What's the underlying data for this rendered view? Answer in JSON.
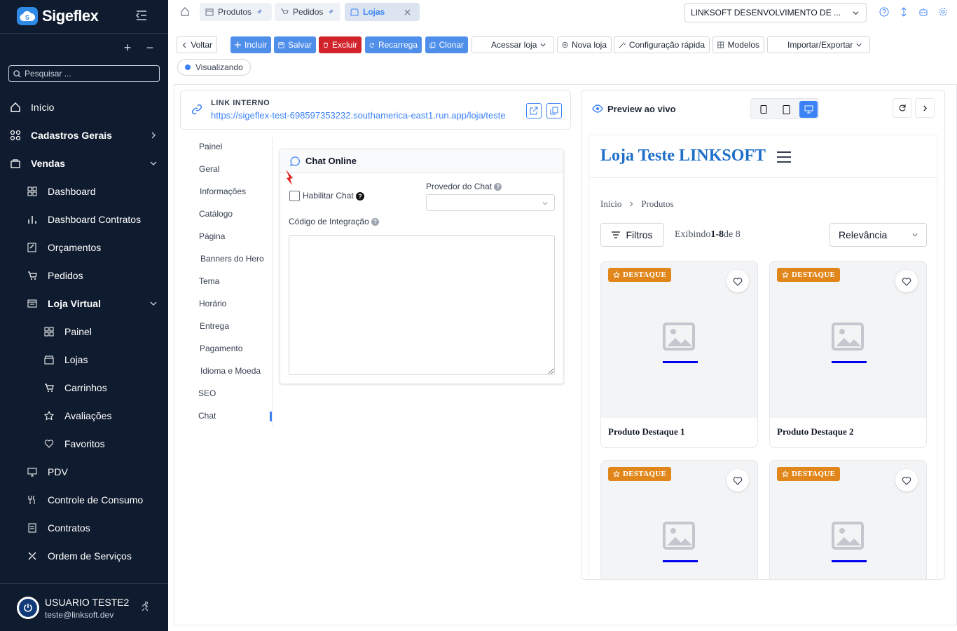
{
  "brand": {
    "name": "Sigeflex"
  },
  "sidebar": {
    "controls": {
      "add": "+",
      "remove": "−"
    },
    "search_placeholder": "Pesquisar ...",
    "items": [
      {
        "label": "Início"
      },
      {
        "label": "Cadastros Gerais"
      },
      {
        "label": "Vendas"
      },
      {
        "label": "Dashboard"
      },
      {
        "label": "Dashboard Contratos"
      },
      {
        "label": "Orçamentos"
      },
      {
        "label": "Pedidos"
      },
      {
        "label": "Loja Virtual"
      },
      {
        "label": "Painel"
      },
      {
        "label": "Lojas"
      },
      {
        "label": "Carrinhos"
      },
      {
        "label": "Avaliações"
      },
      {
        "label": "Favoritos"
      },
      {
        "label": "PDV"
      },
      {
        "label": "Controle de Consumo"
      },
      {
        "label": "Contratos"
      },
      {
        "label": "Ordem de Serviços"
      }
    ],
    "user": {
      "name": "USUARIO TESTE2",
      "email": "teste@linksoft.dev"
    }
  },
  "tabs": [
    {
      "label": "Produtos"
    },
    {
      "label": "Pedidos"
    },
    {
      "label": "Lojas"
    }
  ],
  "company_select": "LINKSOFT DESENVOLVIMENTO DE ...",
  "toolbar": {
    "back": "Voltar",
    "add": "Incluir",
    "save": "Salvar",
    "delete": "Excluir",
    "reload": "Recarrega",
    "clone": "Clonar",
    "access_store": "Acessar loja",
    "new_store": "Nova loja",
    "quick_config": "Configuração rápida",
    "models": "Modelos",
    "import_export": "Importar/Exportar"
  },
  "status": "Visualizando",
  "link": {
    "label": "LINK INTERNO",
    "url": "https://sigeflex-test-698597353232.southamerica-east1.run.app/loja/teste"
  },
  "subnav": [
    "Painel",
    "Geral",
    "Informações",
    "Catálogo",
    "Página",
    "Banners do Hero",
    "Tema",
    "Horário",
    "Entrega",
    "Pagamento",
    "Idioma e Moeda",
    "SEO",
    "Chat"
  ],
  "chat_card": {
    "title": "Chat Online",
    "enable_label": "Habilitar Chat",
    "provider_label": "Provedor do Chat",
    "integration_label": "Código de Integração"
  },
  "preview": {
    "title": "Preview ao vivo",
    "store_name": "Loja Teste LINKSOFT",
    "breadcrumb": [
      "Início",
      "Produtos"
    ],
    "filters": "Filtros",
    "showing_prefix": "Exibindo",
    "showing_range": "1-8",
    "showing_suffix": "de 8",
    "sort": "Relevância",
    "badge": "DESTAQUE",
    "products": [
      "Produto Destaque 1",
      "Produto Destaque 2",
      "",
      ""
    ]
  },
  "colors": {
    "sidebar": "#0f1b2e",
    "accent": "#3b82f6",
    "danger": "#d3232a",
    "badge": "#e0861a",
    "store": "#1f6fc9"
  }
}
